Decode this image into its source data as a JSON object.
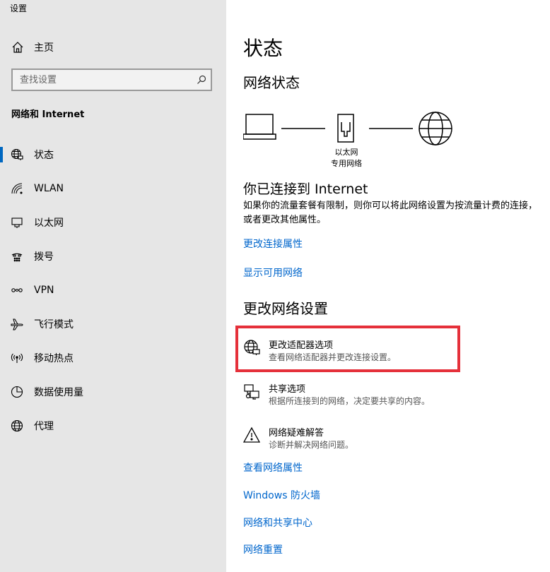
{
  "window": {
    "title": "设置"
  },
  "sidebar": {
    "home_label": "主页",
    "search_placeholder": "查找设置",
    "group_title": "网络和 Internet",
    "items": [
      {
        "label": "状态",
        "icon": "globe-status-icon",
        "active": true
      },
      {
        "label": "WLAN",
        "icon": "wifi-icon"
      },
      {
        "label": "以太网",
        "icon": "ethernet-icon"
      },
      {
        "label": "拨号",
        "icon": "dialup-icon"
      },
      {
        "label": "VPN",
        "icon": "vpn-icon"
      },
      {
        "label": "飞行模式",
        "icon": "airplane-icon"
      },
      {
        "label": "移动热点",
        "icon": "hotspot-icon"
      },
      {
        "label": "数据使用量",
        "icon": "data-usage-icon"
      },
      {
        "label": "代理",
        "icon": "globe-proxy-icon"
      }
    ]
  },
  "main": {
    "title": "状态",
    "network_status_heading": "网络状态",
    "diagram": {
      "adapter_name": "以太网",
      "network_name": "专用网络"
    },
    "connected_heading": "你已连接到 Internet",
    "connected_desc": "如果你的流量套餐有限制，则你可以将此网络设置为按流量计费的连接，或者更改其他属性。",
    "links_top": [
      "更改连接属性",
      "显示可用网络"
    ],
    "change_heading": "更改网络设置",
    "options": [
      {
        "title": "更改适配器选项",
        "desc": "查看网络适配器并更改连接设置。",
        "icon": "adapter-icon",
        "highlighted": true
      },
      {
        "title": "共享选项",
        "desc": "根据所连接到的网络，决定要共享的内容。",
        "icon": "sharing-icon"
      },
      {
        "title": "网络疑难解答",
        "desc": "诊断并解决网络问题。",
        "icon": "warning-icon"
      }
    ],
    "links_bottom": [
      "查看网络属性",
      "Windows 防火墙",
      "网络和共享中心",
      "网络重置"
    ]
  },
  "colors": {
    "sidebar_bg": "#e6e6e6",
    "accent": "#0067c0",
    "link": "#0066cc",
    "highlight": "#e5303a"
  }
}
